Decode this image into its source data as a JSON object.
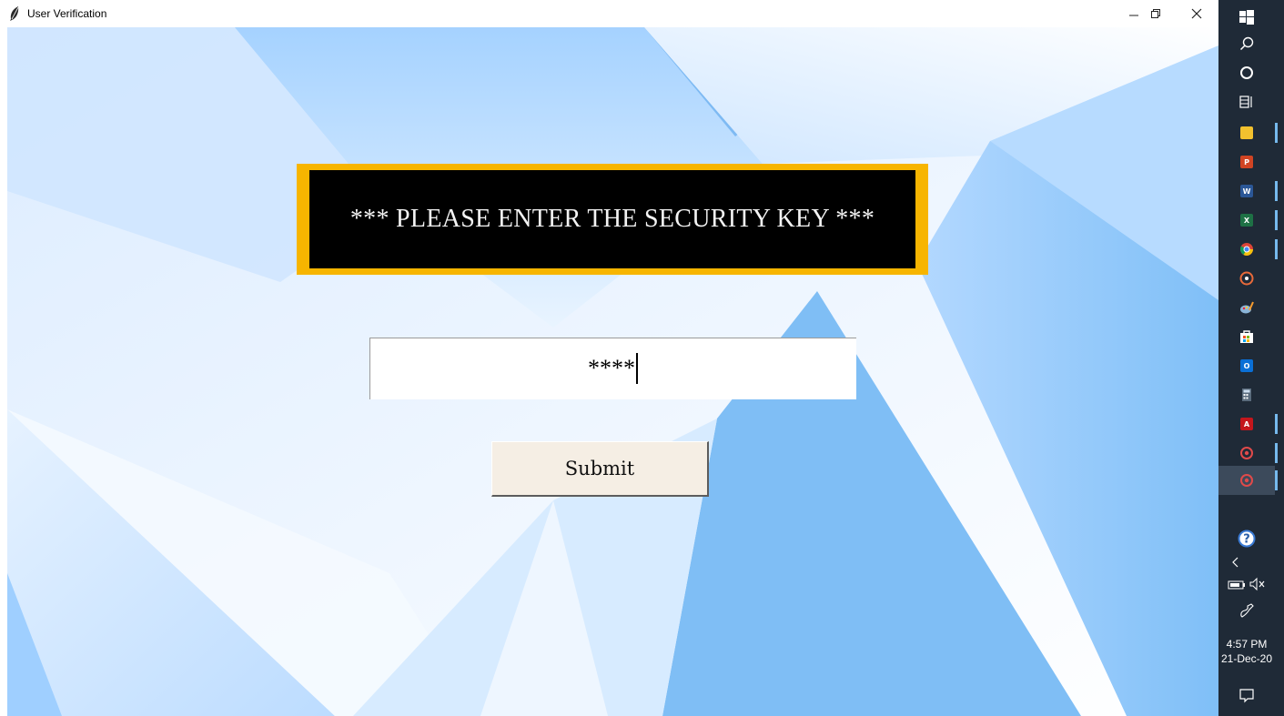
{
  "window": {
    "title": "User Verification"
  },
  "banner": {
    "text": "*** PLEASE ENTER THE SECURITY KEY ***"
  },
  "security_key": {
    "value": "****"
  },
  "submit": {
    "label": "Submit"
  },
  "taskbar": {
    "time": "4:57 PM",
    "date": "21-Dec-20",
    "pinned_apps": [
      "start-icon",
      "search-icon",
      "cortana-icon",
      "task-view-icon",
      "file-explorer-icon",
      "powerpoint-icon",
      "word-icon",
      "excel-icon",
      "chrome-icon",
      "media-icon",
      "paint-icon",
      "store-icon",
      "outlook-icon",
      "calculator-icon",
      "acrobat-icon",
      "app-icon",
      "app-icon"
    ],
    "tray": [
      "help-icon",
      "chevron-left-icon",
      "battery-icon",
      "volume-muted-icon",
      "pen-icon",
      "notifications-icon"
    ]
  },
  "colors": {
    "banner_border": "#f7b500",
    "banner_bg": "#000000",
    "button_bg": "#f5eee4",
    "taskbar_bg": "#1f2a37"
  }
}
